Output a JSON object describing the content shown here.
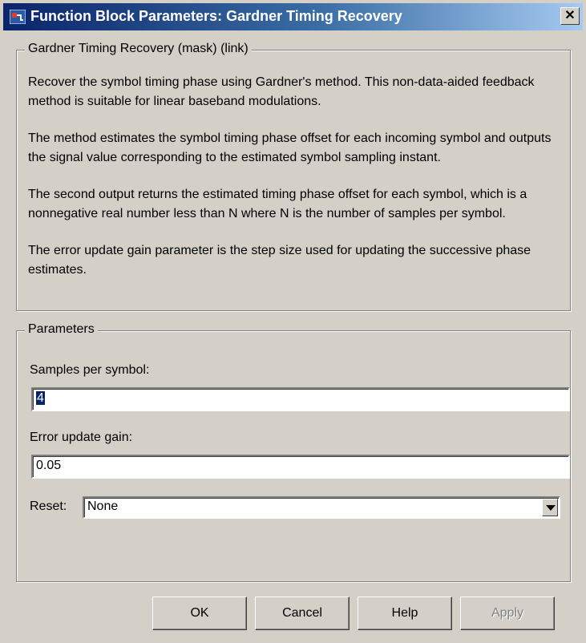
{
  "window": {
    "title": "Function Block Parameters: Gardner Timing Recovery",
    "close_label": "✕"
  },
  "description_group": {
    "legend": "Gardner Timing Recovery (mask) (link)",
    "paragraphs": [
      "Recover the symbol timing phase using Gardner's method. This non-data-aided feedback method is suitable for linear baseband modulations.",
      "The method estimates the symbol timing phase offset for each incoming symbol and outputs the signal value corresponding to the estimated symbol sampling instant.",
      "The second output returns the estimated timing phase offset for each symbol, which is a nonnegative real number less than N where N is the number of samples per symbol.",
      "The error update gain parameter is the step size used for updating the successive phase estimates."
    ]
  },
  "parameters_group": {
    "legend": "Parameters",
    "samples_per_symbol": {
      "label": "Samples per symbol:",
      "value": "4"
    },
    "error_update_gain": {
      "label": "Error update gain:",
      "value": "0.05"
    },
    "reset": {
      "label": "Reset:",
      "value": "None"
    }
  },
  "buttons": {
    "ok": "OK",
    "cancel": "Cancel",
    "help": "Help",
    "apply": "Apply"
  },
  "icons": {
    "title_icon": "simulink-block-icon",
    "close": "close-icon",
    "dropdown": "chevron-down-icon"
  }
}
